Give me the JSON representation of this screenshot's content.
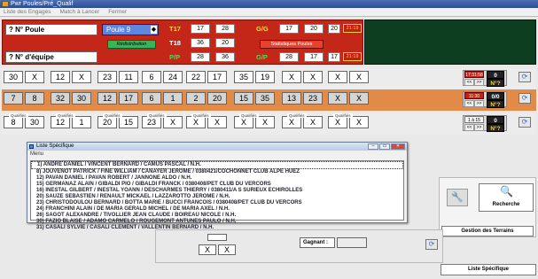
{
  "window": {
    "title": "Pwr Poules/Pré_Qualif"
  },
  "menu": {
    "items": [
      "Liste des Engagés",
      "Match à Lancer",
      "Fermer"
    ]
  },
  "header": {
    "poule_label": "? N° Poule",
    "poule_value": "Poule 9",
    "equipe_label": "? N° d'équipe",
    "green_button": "Rédistribution",
    "red_button": "Statistiques Poules",
    "t17": {
      "label": "T17",
      "values": [
        "17",
        "28"
      ]
    },
    "t18": {
      "label": "T18",
      "values": [
        "36",
        "20"
      ]
    },
    "pp": {
      "label": "P/P",
      "values": [
        "28",
        "36"
      ]
    },
    "gg": {
      "label": "G/G",
      "values": [
        "17",
        "20",
        "20"
      ],
      "time": "21:19"
    },
    "gp": {
      "label": "G/P",
      "values": [
        "28",
        "17",
        "17"
      ],
      "time": "21:19"
    }
  },
  "rows": [
    {
      "cells": [
        "30",
        "X",
        "12",
        "X",
        "23",
        "11",
        "6",
        "24",
        "22",
        "17",
        "35",
        "19",
        "X",
        "X",
        "X",
        "X"
      ],
      "time": "17:31:58",
      "counter": "0",
      "nav_prev": "<<",
      "nav_next": ">>",
      "n_label": "N°?"
    },
    {
      "cells": [
        "7",
        "8",
        "32",
        "30",
        "12",
        "17",
        "6",
        "1",
        "2",
        "20",
        "15",
        "35",
        "13",
        "23",
        "X",
        "X"
      ],
      "time": "11:30",
      "counter": "0/0",
      "nav_prev": "<<",
      "nav_next": ">>",
      "n_label": "N°?"
    },
    {
      "qualif_label": "Qualifiés",
      "cells": [
        "8",
        "30",
        "12",
        "1",
        "20",
        "15",
        "23",
        "X",
        "X",
        "X",
        "X",
        "X",
        "X",
        "X",
        "X",
        "X"
      ],
      "time": "1 à 15",
      "counter": "0",
      "nav_prev": "<<",
      "nav_next": ">>",
      "n_label": "N°?"
    }
  ],
  "dialog": {
    "title": "Liste Spécifique",
    "menu": "Menu",
    "items": [
      "1) ANDRE DANIEL / VINCENT BERNARD / CAMUS PASCAL / N.H.",
      "8) JOUVENOT PATRICK / FINE WILLIAM / CANAYER JEROME / 0380421/COCHONNET CLUB ALPE HUEZ",
      "12) PAVAN DANIEL / PAVAN ROBERT / JANNONE ALDO / N.H.",
      "15) GERMANAZ ALAIN / GIBALDI PIO / GIBALDI FRANCK / 0380408/PET CLUB DU VERCORS",
      "16) INESTAL GILBERT / INESTAL YOANN / DESCHARMES THIERRY / 0380411/A S SURIEUX ECHIROLLES",
      "20) SAUZE SEBASTIEN / RENAULT MICKAEL / LAZZAROTTO JEROME / N.H.",
      "23) CHRISTODOULOU BERNARD / BOTTA MARIE / BUCCI FRANCOIS / 0380408/PET CLUB DU VERCORS",
      "24) FRANCHINI ALAIN / DE MARIA GERALD MICHEL / DE MARIA AXEL / N.H.",
      "26) SAGOT ALEXANDRE / TIVOLLIER JEAN CLAUDE / BOIREAU NICOLE / N.H.",
      "30) FAZIO BLAISE / ADAMO CARMELO / ROUGEMONT ANTUNES PAULO / N.H.",
      "31) CASALI SYLVIE / CASALI CLEMENT / VALLENTIN BERNARD / N.H."
    ]
  },
  "side": {
    "recherche": "Recherche",
    "gestion": "Gestion des Terrains",
    "liste": "Liste Spécifique"
  },
  "footer": {
    "x1": "X",
    "x2": "X",
    "gagnant_label": "Gagnant :",
    "gagnant_value": ""
  }
}
